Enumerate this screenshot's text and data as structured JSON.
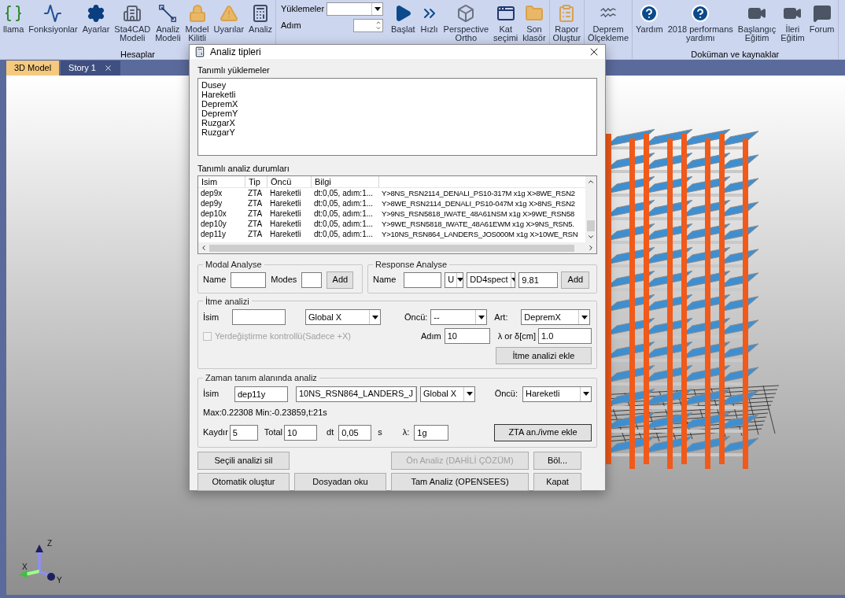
{
  "ribbon": {
    "groups": [
      {
        "label": "Hesaplar",
        "items": [
          {
            "lines": [
              "llama"
            ]
          },
          {
            "lines": [
              "Fonksiyonlar"
            ]
          },
          {
            "lines": [
              "Ayarlar"
            ]
          },
          {
            "lines": [
              "Sta4CAD",
              "Modeli"
            ]
          },
          {
            "lines": [
              "Analiz",
              "Modeli"
            ]
          },
          {
            "lines": [
              "Model",
              "Kilitli"
            ]
          },
          {
            "lines": [
              "Uyarılar"
            ]
          },
          {
            "lines": [
              "Analiz"
            ]
          }
        ]
      },
      {
        "fields": [
          {
            "label": "Yüklemeler",
            "kind": "combo"
          },
          {
            "label": "Adım",
            "kind": "spinner"
          }
        ],
        "items": [
          {
            "lines": [
              "Başlat"
            ]
          },
          {
            "lines": [
              "Hızlı"
            ]
          },
          {
            "lines": [
              "Perspective",
              "Ortho"
            ]
          },
          {
            "lines": [
              "Kat",
              "seçimi"
            ]
          },
          {
            "lines": [
              "Son",
              "klasör"
            ]
          }
        ]
      },
      {
        "items": [
          {
            "lines": [
              "Rapor",
              "Oluştur"
            ]
          }
        ]
      },
      {
        "items": [
          {
            "lines": [
              "Deprem",
              "Ölçekleme"
            ]
          }
        ]
      },
      {
        "label": "Doküman ve kaynaklar",
        "items": [
          {
            "lines": [
              "Yardım"
            ]
          },
          {
            "lines": [
              "2018 performans",
              "yardımı"
            ]
          },
          {
            "lines": [
              "Başlangıç",
              "Eğitim"
            ]
          },
          {
            "lines": [
              "İleri",
              "Eğitim"
            ]
          },
          {
            "lines": [
              "Forum"
            ]
          }
        ]
      }
    ]
  },
  "tabs": [
    {
      "label": "3D Model",
      "selected": true,
      "closable": false
    },
    {
      "label": "Story 1",
      "selected": false,
      "closable": true
    }
  ],
  "viewport": {
    "axes": [
      "Z",
      "X",
      "Y"
    ]
  },
  "dialog": {
    "title": "Analiz tipleri",
    "loads": {
      "label": "Tanımlı yüklemeler",
      "items": [
        "Dusey",
        "Hareketli",
        "DepremX",
        "DepremY",
        "RuzgarX",
        "RuzgarY"
      ]
    },
    "cases": {
      "label": "Tanımlı analiz durumları",
      "columns": [
        "Isim",
        "Tip",
        "Öncü",
        "Bilgi"
      ],
      "rows": [
        {
          "cells": [
            "dep9x",
            "ZTA",
            "Hareketli",
            "dt:0,05, adım:1...",
            "Y>8NS_RSN2114_DENALI_PS10-317M x1g X>8WE_RSN2"
          ]
        },
        {
          "cells": [
            "dep9y",
            "ZTA",
            "Hareketli",
            "dt:0,05, adım:1...",
            "Y>8WE_RSN2114_DENALI_PS10-047M x1g X>8NS_RSN2"
          ]
        },
        {
          "cells": [
            "dep10x",
            "ZTA",
            "Hareketli",
            "dt:0,05, adım:1...",
            "Y>9NS_RSN5818_IWATE_48A61NSM x1g X>9WE_RSN58"
          ]
        },
        {
          "cells": [
            "dep10y",
            "ZTA",
            "Hareketli",
            "dt:0,05, adım:1...",
            "Y>9WE_RSN5818_IWATE_48A61EWM x1g X>9NS_RSN5."
          ]
        },
        {
          "cells": [
            "dep11y",
            "ZTA",
            "Hareketli",
            "dt:0,05, adım:1...",
            "Y>10NS_RSN864_LANDERS_JOS000M x1g X>10WE_RSN"
          ]
        }
      ]
    },
    "modal": {
      "title": "Modal Analyse",
      "name_label": "Name",
      "modes_label": "Modes",
      "button": "Add"
    },
    "response": {
      "title": "Response Analyse",
      "name_label": "Name",
      "unit": "U",
      "spectrum": "DD4spect",
      "factor": "9.81",
      "button": "Add"
    },
    "pushover": {
      "title": "İtme analizi",
      "name_label": "İsim",
      "direction": "Global X",
      "precursor_label": "Öncü:",
      "precursor": "--",
      "load_label": "Art:",
      "load": "DepremX",
      "checkbox": {
        "label": "Yerdeğiştirme kontrollü(Sadece +X)",
        "checked": false,
        "disabled": true
      },
      "steps_label": "Adım",
      "steps": "10",
      "lambda_label": "λ or δ[cm]",
      "lambda": "1.0",
      "button": "İtme analizi ekle"
    },
    "time_history": {
      "title": "Zaman tanım alanında analiz",
      "name_label": "İsim",
      "name": "dep11y",
      "record": "10NS_RSN864_LANDERS_J",
      "direction": "Global X",
      "precursor_label": "Öncü:",
      "precursor": "Hareketli",
      "info": "Max:0.22308 Min:-0.23859,t:21s",
      "shift_label": "Kaydır",
      "shift": "5",
      "total_label": "Total",
      "total": "10",
      "dt_label": "dt",
      "dt": "0,05",
      "dt_unit": "s",
      "scale_label": "λ:",
      "scale": "1g",
      "button": "ZTA an./ivme ekle"
    },
    "buttons": [
      {
        "label": "Seçili analizi sil",
        "disabled": false
      },
      {
        "label": "Ön Analiz (DAHİLİ ÇÖZÜM)",
        "disabled": true
      },
      {
        "label": "Böl...",
        "disabled": false
      },
      {
        "label": "Otomatik oluştur",
        "disabled": false
      },
      {
        "label": "Dosyadan oku",
        "disabled": false
      },
      {
        "label": "Tam Analiz (OPENSEES)",
        "disabled": false
      },
      {
        "label": "Kapat",
        "disabled": false
      }
    ]
  }
}
